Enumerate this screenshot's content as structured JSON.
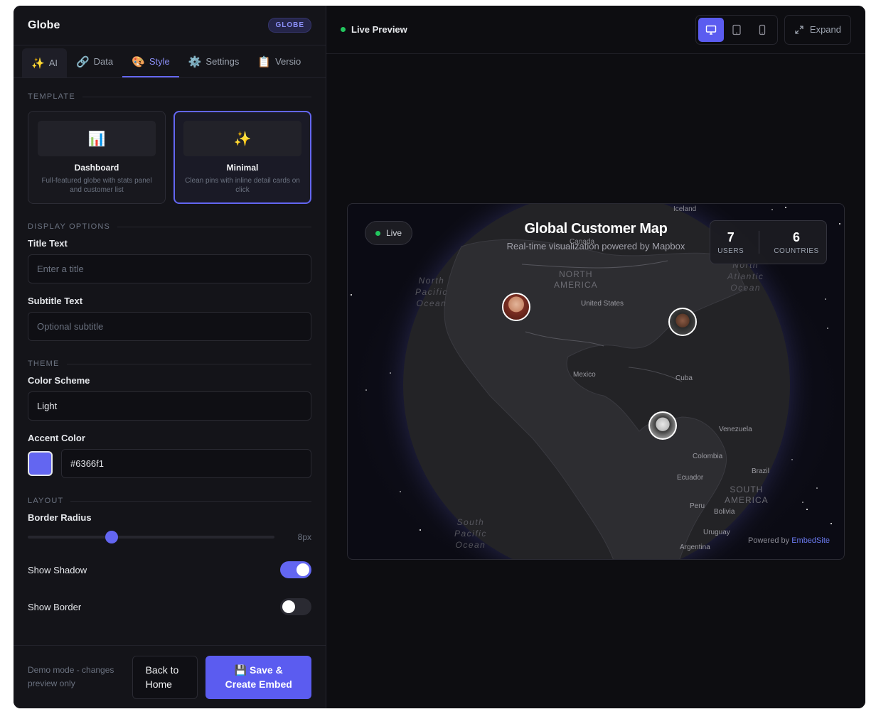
{
  "panel": {
    "title": "Globe",
    "badge": "GLOBE",
    "tabs": [
      {
        "label": "AI",
        "icon": "sparkles-icon"
      },
      {
        "label": "Data",
        "icon": "link-icon"
      },
      {
        "label": "Style",
        "icon": "palette-icon"
      },
      {
        "label": "Settings",
        "icon": "gear-icon"
      },
      {
        "label": "Versio",
        "icon": "clipboard-icon"
      }
    ],
    "active_tab": "Style"
  },
  "template": {
    "section": "TEMPLATE",
    "options": [
      {
        "name": "Dashboard",
        "desc": "Full-featured globe with stats panel and customer list",
        "icon": "bar-chart-icon",
        "selected": false
      },
      {
        "name": "Minimal",
        "desc": "Clean pins with inline detail cards on click",
        "icon": "sparkles-icon",
        "selected": true
      }
    ]
  },
  "display": {
    "section": "DISPLAY OPTIONS",
    "title_label": "Title Text",
    "title_placeholder": "Enter a title",
    "subtitle_label": "Subtitle Text",
    "subtitle_placeholder": "Optional subtitle"
  },
  "theme": {
    "section": "THEME",
    "scheme_label": "Color Scheme",
    "scheme_value": "Light",
    "accent_label": "Accent Color",
    "accent_value": "#6366f1",
    "accent_color": "#6366f1"
  },
  "layout": {
    "section": "LAYOUT",
    "radius_label": "Border Radius",
    "radius_value": "8px",
    "radius_fraction": 0.34,
    "shadow_label": "Show Shadow",
    "shadow_on": true,
    "border_label": "Show Border",
    "border_on": false
  },
  "footer": {
    "note": "Demo mode - changes preview only",
    "back_line1": "Back to",
    "back_line2": "Home",
    "save_line1": "💾 Save &",
    "save_line2": "Create Embed"
  },
  "preview": {
    "label": "Live Preview",
    "expand": "Expand",
    "devices": [
      "desktop-icon",
      "tablet-icon",
      "phone-icon"
    ],
    "active_device": "desktop-icon"
  },
  "map": {
    "live": "Live",
    "title": "Global Customer Map",
    "subtitle": "Real-time visualization powered by Mapbox",
    "users_count": "7",
    "users_label": "USERS",
    "countries_count": "6",
    "countries_label": "COUNTRIES",
    "powered_prefix": "Powered by",
    "powered_brand": "EmbedSite",
    "labels": {
      "iceland": "Iceland",
      "canada": "Canada",
      "north_america_1": "NORTH",
      "north_america_2": "AMERICA",
      "united_states": "United States",
      "north_atlantic_1": "North",
      "north_atlantic_2": "Atlantic",
      "north_atlantic_3": "Ocean",
      "north_pacific_1": "North",
      "north_pacific_2": "Pacific",
      "north_pacific_3": "Ocean",
      "mexico": "Mexico",
      "cuba": "Cuba",
      "venezuela": "Venezuela",
      "colombia": "Colombia",
      "ecuador": "Ecuador",
      "brazil": "Brazil",
      "south_america_1": "SOUTH",
      "south_america_2": "AMERICA",
      "peru": "Peru",
      "bolivia": "Bolivia",
      "south_pacific_1": "South",
      "south_pacific_2": "Pacific",
      "south_pacific_3": "Ocean",
      "uruguay": "Uruguay",
      "argentina": "Argentina"
    }
  }
}
